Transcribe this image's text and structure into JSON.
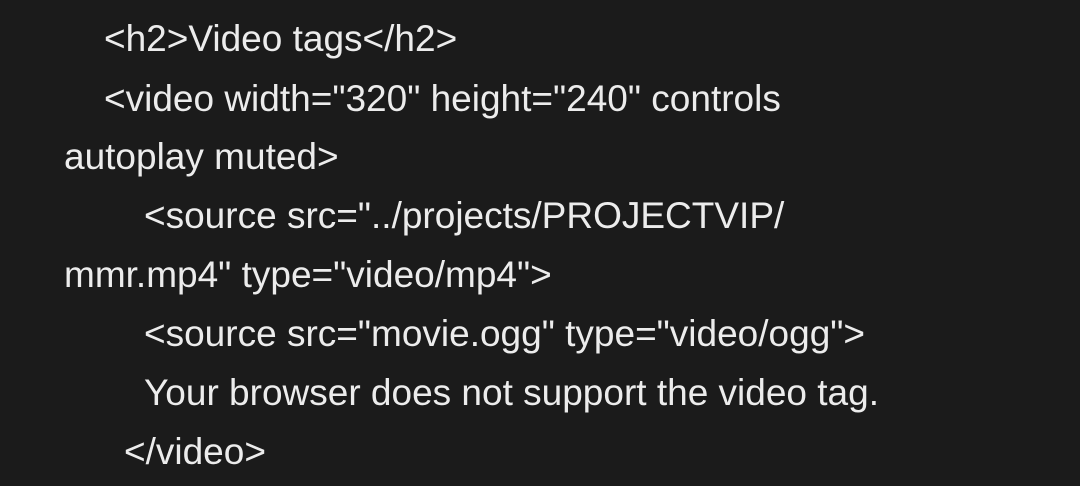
{
  "editor": {
    "lines": [
      "<h2>Video tags</h2>",
      "<video width=\"320\" height=\"240\" controls",
      "autoplay muted>",
      "<source src=\"../projects/PROJECTVIP/",
      "mmr.mp4\" type=\"video/mp4\">",
      "<source src=\"movie.ogg\" type=\"video/ogg\">",
      "Your browser does not support the video tag.",
      "</video>"
    ]
  },
  "colors": {
    "background": "#1b1b1b",
    "text": "#ececec"
  }
}
